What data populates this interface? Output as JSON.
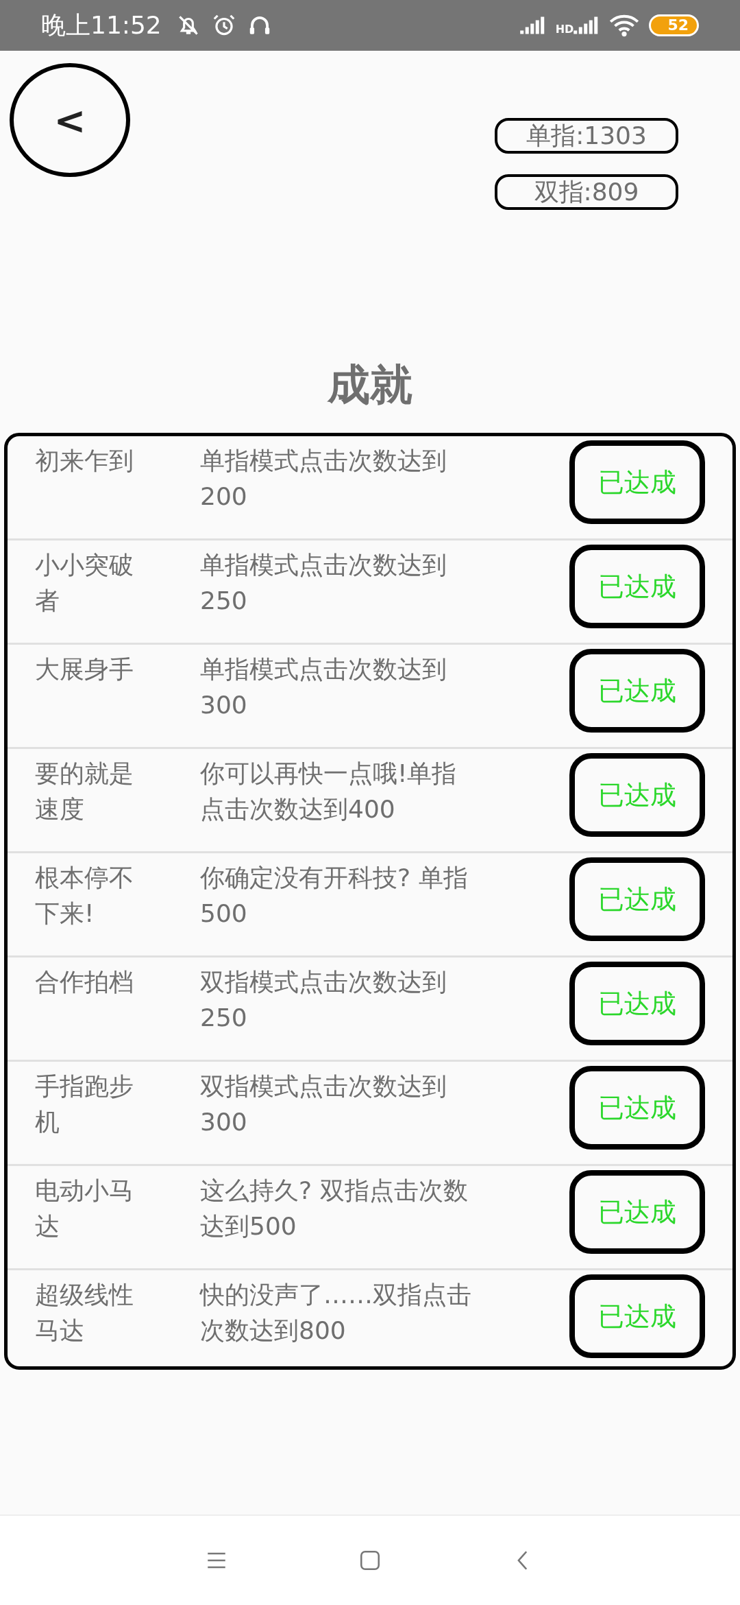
{
  "status_bar": {
    "time": "晚上11:52",
    "network_label": "HD",
    "battery": "52"
  },
  "back_button": {
    "label": "<"
  },
  "counters": [
    {
      "label": "单指:1303"
    },
    {
      "label": "双指:809"
    }
  ],
  "title": "成就",
  "achievements": [
    {
      "name": "初来乍到",
      "description": "单指模式点击次数达到200",
      "status": "已达成"
    },
    {
      "name": "小小突破者",
      "description": "单指模式点击次数达到250",
      "status": "已达成"
    },
    {
      "name": "大展身手",
      "description": "单指模式点击次数达到300",
      "status": "已达成"
    },
    {
      "name": "要的就是速度",
      "description": "你可以再快一点哦!单指点击次数达到400",
      "status": "已达成"
    },
    {
      "name": "根本停不下来!",
      "description": "你确定没有开科技? 单指500",
      "status": "已达成"
    },
    {
      "name": "合作拍档",
      "description": "双指模式点击次数达到250",
      "status": "已达成"
    },
    {
      "name": "手指跑步机",
      "description": "双指模式点击次数达到300",
      "status": "已达成"
    },
    {
      "name": "电动小马达",
      "description": "这么持久? 双指点击次数达到500",
      "status": "已达成"
    },
    {
      "name": "超级线性马达",
      "description": "快的没声了……双指点击次数达到800",
      "status": "已达成"
    }
  ]
}
